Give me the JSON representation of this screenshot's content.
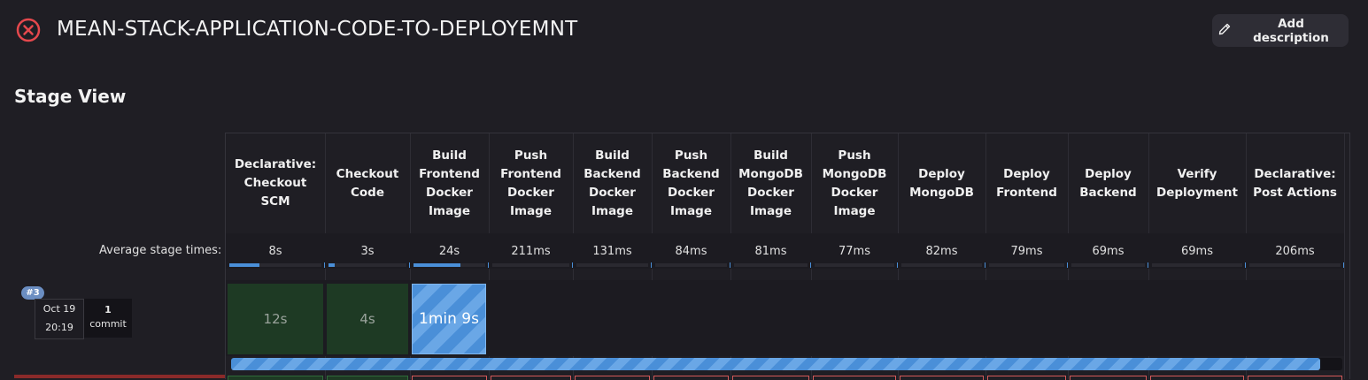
{
  "header": {
    "title": "MEAN-STACK-APPLICATION-CODE-TO-DEPLOYEMNT",
    "status_icon": "failed-x-circle-icon",
    "add_description_label": "Add description"
  },
  "stage_view": {
    "title": "Stage View",
    "average_label": "Average stage times:",
    "stages": [
      {
        "name": "Declarative: Checkout SCM",
        "avg": "8s",
        "avg_fraction": 0.33
      },
      {
        "name": "Checkout Code",
        "avg": "3s",
        "avg_fraction": 0.08
      },
      {
        "name": "Build Frontend Docker Image",
        "avg": "24s",
        "avg_fraction": 0.65
      },
      {
        "name": "Push Frontend Docker Image",
        "avg": "211ms",
        "avg_fraction": 0.0
      },
      {
        "name": "Build Backend Docker Image",
        "avg": "131ms",
        "avg_fraction": 0.0
      },
      {
        "name": "Push Backend Docker Image",
        "avg": "84ms",
        "avg_fraction": 0.0
      },
      {
        "name": "Build MongoDB Docker Image",
        "avg": "81ms",
        "avg_fraction": 0.0
      },
      {
        "name": "Push MongoDB Docker Image",
        "avg": "77ms",
        "avg_fraction": 0.0
      },
      {
        "name": "Deploy MongoDB",
        "avg": "82ms",
        "avg_fraction": 0.0
      },
      {
        "name": "Deploy Frontend",
        "avg": "79ms",
        "avg_fraction": 0.0
      },
      {
        "name": "Deploy Backend",
        "avg": "69ms",
        "avg_fraction": 0.0
      },
      {
        "name": "Verify Deployment",
        "avg": "69ms",
        "avg_fraction": 0.0
      },
      {
        "name": "Declarative: Post Actions",
        "avg": "206ms",
        "avg_fraction": 0.0
      }
    ],
    "builds": [
      {
        "number": "#3",
        "date": "Oct 19",
        "time": "20:19",
        "commit_count": "1",
        "commit_label": "commit",
        "progress_fraction": 0.98,
        "cells": [
          {
            "text": "12s",
            "status": "success"
          },
          {
            "text": "4s",
            "status": "success"
          },
          {
            "text": "1min 9s",
            "status": "running"
          }
        ]
      }
    ],
    "colors": {
      "success": "#1e3a24",
      "running": "#4a8fd8",
      "failed": "#d45a5a",
      "background": "#1f1e24"
    }
  }
}
